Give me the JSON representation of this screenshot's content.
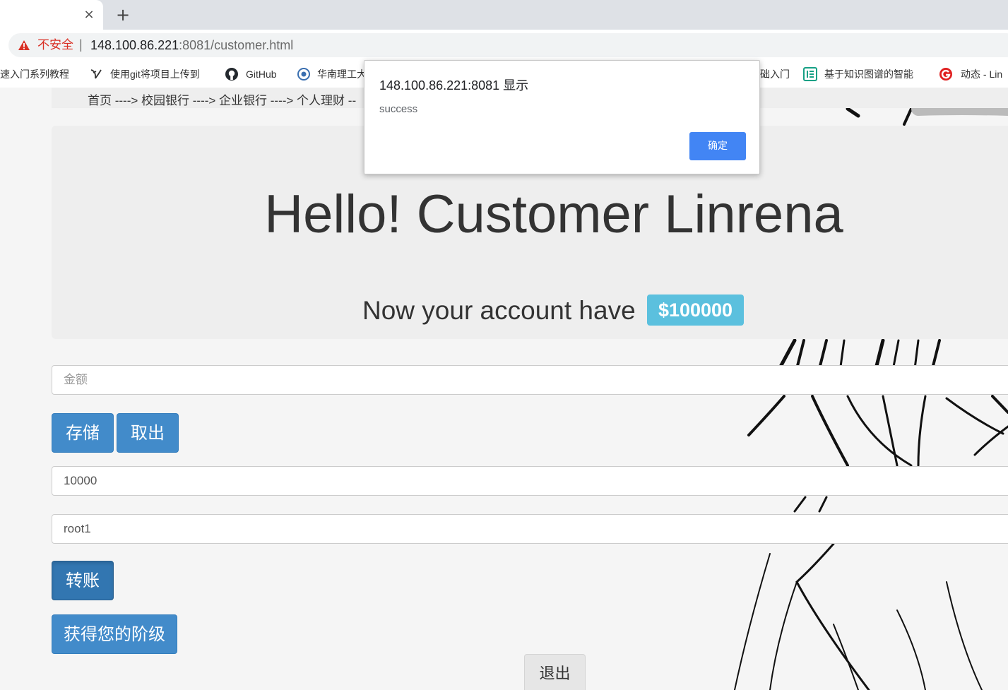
{
  "browser": {
    "tab_close": "×",
    "new_tab": "+",
    "security_label": "不安全",
    "separator": "|",
    "url_host": "148.100.86.221",
    "url_rest": ":8081/customer.html",
    "bookmarks": [
      {
        "label": "速入门系列教程",
        "icon": "none"
      },
      {
        "label": "使用git将项目上传到",
        "icon": "git-leaf-icon"
      },
      {
        "label": "GitHub",
        "icon": "github-icon"
      },
      {
        "label": "华南理工大",
        "icon": "university-icon"
      },
      {
        "label": "础入门",
        "icon": "none"
      },
      {
        "label": "基于知识图谱的智能",
        "icon": "document-app-icon"
      },
      {
        "label": "动态 - Lin",
        "icon": "red-g-icon"
      }
    ]
  },
  "page": {
    "breadcrumb": "首页 ----> 校园银行 ----> 企业银行 ----> 个人理财 --",
    "greeting": "Hello! Customer Linrena",
    "account_text": "Now your account have",
    "balance": "$100000",
    "amount_placeholder": "金额",
    "deposit_label": "存储",
    "withdraw_label": "取出",
    "transfer_amount": "10000",
    "transfer_target": "root1",
    "transfer_label": "转账",
    "level_label": "获得您的阶级",
    "logout_label": "退出"
  },
  "dialog": {
    "title": "148.100.86.221:8081 显示",
    "message": "success",
    "ok_label": "确定"
  },
  "colors": {
    "primary_button": "#428bca",
    "badge": "#5bc0de",
    "dialog_ok": "#4285f4",
    "warning": "#d93025"
  }
}
